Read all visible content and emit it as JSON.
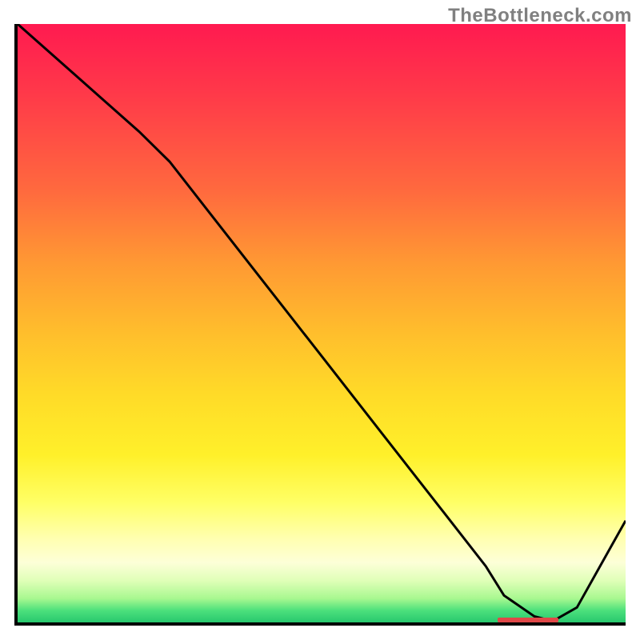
{
  "watermark": "TheBottleneck.com",
  "colors": {
    "axis": "#000000",
    "curve": "#000000",
    "marker": "#e04848",
    "gradient_top": "#ff1a50",
    "gradient_bottom": "#28c86e"
  },
  "chart_data": {
    "type": "line",
    "title": "",
    "xlabel": "",
    "ylabel": "",
    "xlim": [
      0,
      100
    ],
    "ylim": [
      0,
      100
    ],
    "x": [
      0,
      10,
      20,
      25,
      30,
      40,
      50,
      60,
      70,
      77,
      80,
      85,
      88,
      92,
      100
    ],
    "y": [
      100,
      91,
      82,
      77,
      70.5,
      57.5,
      44.5,
      31.5,
      18.5,
      9.4,
      4.5,
      1.0,
      0.2,
      2.5,
      17
    ],
    "minimum_region": {
      "x_start": 79,
      "x_end": 89,
      "y": 0.4
    }
  }
}
